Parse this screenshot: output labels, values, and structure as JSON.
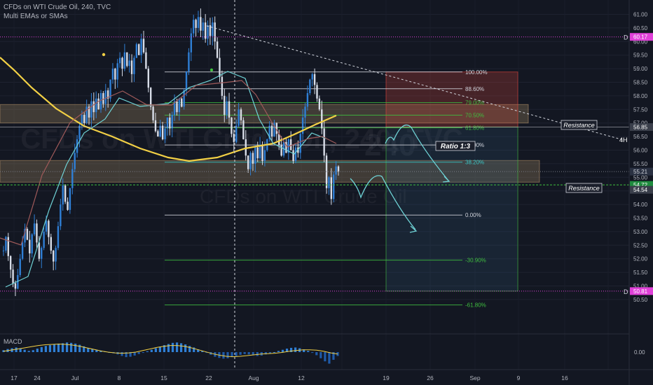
{
  "header": {
    "symbol_title": "CFDs on WTI Crude Oil, 240, TVC",
    "indicator_label": "Multi EMAs or SMAs"
  },
  "watermark": {
    "interval": "240",
    "name": "CFDs on WTI Crude Oil"
  },
  "macd_label": "MACD",
  "colors": {
    "background": "#131722",
    "bull": "#2f7fd6",
    "bear": "#d8dde8",
    "ema_yellow": "#f2d045",
    "ma_cyan": "#6fd3d6",
    "ma_brown": "#a05a5a",
    "resistance_zone": "#c8a070",
    "fib_green": "#3fbf3f",
    "fib_white": "#d1d4dc",
    "fib_cyan": "#39c7c7",
    "marker_magenta": "#e040d8",
    "current_price": "#2a3142"
  },
  "price_axis": {
    "ticks": [
      "61.00",
      "60.50",
      "60.00",
      "59.50",
      "59.00",
      "58.50",
      "58.00",
      "57.50",
      "57.00",
      "56.50",
      "56.00",
      "55.50",
      "55.00",
      "54.50",
      "54.00",
      "53.50",
      "53.00",
      "52.50",
      "52.00",
      "51.50",
      "51.00",
      "50.50"
    ],
    "badges": [
      {
        "text": "60.17",
        "kind": "magenta"
      },
      {
        "text": "56.85",
        "kind": "dark"
      },
      {
        "text": "55.21",
        "kind": "current"
      },
      {
        "text": "54.72",
        "kind": "green"
      },
      {
        "text": "54.54",
        "kind": "dark"
      },
      {
        "text": "50.81",
        "kind": "magenta"
      }
    ],
    "macd_tick": "0.00"
  },
  "time_axis": [
    "17",
    "24",
    "Jul",
    "8",
    "15",
    "22",
    "Aug",
    "12",
    "19",
    "26",
    "Sep",
    "9",
    "16"
  ],
  "fib_levels": [
    {
      "label": "100.00%",
      "price": 58.88,
      "color": "#d1d4dc"
    },
    {
      "label": "88.60%",
      "price": 58.26,
      "color": "#d1d4dc"
    },
    {
      "label": "79.00%",
      "price": 57.75,
      "color": "#3fbf3f"
    },
    {
      "label": "70.50%",
      "price": 57.29,
      "color": "#3fbf3f"
    },
    {
      "label": "61.80%",
      "price": 56.82,
      "color": "#3fbf3f"
    },
    {
      "label": "50.00%",
      "price": 56.19,
      "color": "#d1d4dc"
    },
    {
      "label": "38.20%",
      "price": 55.56,
      "color": "#39c7c7"
    },
    {
      "label": "0.00%",
      "price": 53.61,
      "color": "#d1d4dc"
    },
    {
      "label": "-30.90%",
      "price": 51.95,
      "color": "#3fbf3f"
    },
    {
      "label": "-61.80%",
      "price": 50.3,
      "color": "#3fbf3f"
    }
  ],
  "annotations": {
    "resistance_upper": "Resistance",
    "resistance_lower": "Resistance",
    "ratio": "Ratio 1:3",
    "timeframe_4h": "4H",
    "d_upper": "D",
    "d_lower": "D"
  },
  "ohlc_walk": [
    52.3,
    52.8,
    52.1,
    51.6,
    51.1,
    50.9,
    51.4,
    52.0,
    52.6,
    53.1,
    52.7,
    52.2,
    52.9,
    53.3,
    52.6,
    52.0,
    52.4,
    53.0,
    53.4,
    52.8,
    52.3,
    51.9,
    52.4,
    53.2,
    54.0,
    54.7,
    54.1,
    53.8,
    54.6,
    55.3,
    55.9,
    56.4,
    56.9,
    57.3,
    57.0,
    57.6,
    57.2,
    57.8,
    57.4,
    57.9,
    57.5,
    58.1,
    57.7,
    58.2,
    57.9,
    58.6,
    59.0,
    58.6,
    59.2,
    59.4,
    59.0,
    59.6,
    59.1,
    59.3,
    58.8,
    59.4,
    59.9,
    59.5,
    60.1,
    59.6,
    59.0,
    58.3,
    57.6,
    57.1,
    56.7,
    56.5,
    56.9,
    56.4,
    56.8,
    57.2,
    56.8,
    57.3,
    57.8,
    57.4,
    57.9,
    57.6,
    58.2,
    58.9,
    59.6,
    60.3,
    60.8,
    60.5,
    60.9,
    60.4,
    60.7,
    60.1,
    60.6,
    60.2,
    60.7,
    60.0,
    59.4,
    58.7,
    58.0,
    57.3,
    57.8,
    57.2,
    56.6,
    56.3,
    56.9,
    57.5,
    57.1,
    56.4,
    55.8,
    55.3,
    55.9,
    55.5,
    56.1,
    55.7,
    56.2,
    55.6,
    56.0,
    56.4,
    56.9,
    56.5,
    57.0,
    56.6,
    56.2,
    55.8,
    56.3,
    55.9,
    56.4,
    56.0,
    55.6,
    56.1,
    55.9,
    56.6,
    57.2,
    57.6,
    58.1,
    58.6,
    58.8,
    58.4,
    57.9,
    57.5,
    56.8,
    55.8,
    54.6,
    55.0,
    54.2,
    55.1,
    55.4,
    55.2
  ],
  "macd": {
    "histogram": [
      0.05,
      0.08,
      0.1,
      0.12,
      0.1,
      0.06,
      0.03,
      0.05,
      0.09,
      0.13,
      0.16,
      0.18,
      0.2,
      0.22,
      0.23,
      0.25,
      0.24,
      0.22,
      0.19,
      0.15,
      0.11,
      0.08,
      0.06,
      0.04,
      0.02,
      0.0,
      -0.03,
      -0.06,
      -0.1,
      -0.13,
      -0.12,
      -0.09,
      -0.05,
      -0.02,
      0.02,
      0.06,
      0.1,
      0.14,
      0.18,
      0.21,
      0.24,
      0.25,
      0.23,
      0.2,
      0.16,
      0.12,
      0.07,
      0.03,
      -0.02,
      -0.07,
      -0.12,
      -0.15,
      -0.17,
      -0.16,
      -0.13,
      -0.1,
      -0.07,
      -0.05,
      -0.06,
      -0.08,
      -0.1,
      -0.09,
      -0.06,
      -0.03,
      0.0,
      0.03,
      0.06,
      0.09,
      0.11,
      0.12,
      0.1,
      0.07,
      0.03,
      -0.02,
      -0.08,
      -0.16,
      -0.24,
      -0.3,
      -0.2,
      -0.1
    ],
    "signal": [
      0.02,
      0.05,
      0.08,
      0.11,
      0.14,
      0.17,
      0.19,
      0.2,
      0.21,
      0.2,
      0.18,
      0.15,
      0.11,
      0.07,
      0.03,
      0.0,
      -0.02,
      -0.03,
      -0.02,
      0.0,
      0.04,
      0.08,
      0.12,
      0.15,
      0.17,
      0.17,
      0.15,
      0.11,
      0.06,
      0.01,
      -0.04,
      -0.08,
      -0.11,
      -0.12,
      -0.11,
      -0.09,
      -0.07,
      -0.05,
      -0.04,
      -0.03,
      -0.01,
      0.02,
      0.04,
      0.06,
      0.06,
      0.05,
      0.02,
      -0.02,
      -0.05
    ]
  }
}
